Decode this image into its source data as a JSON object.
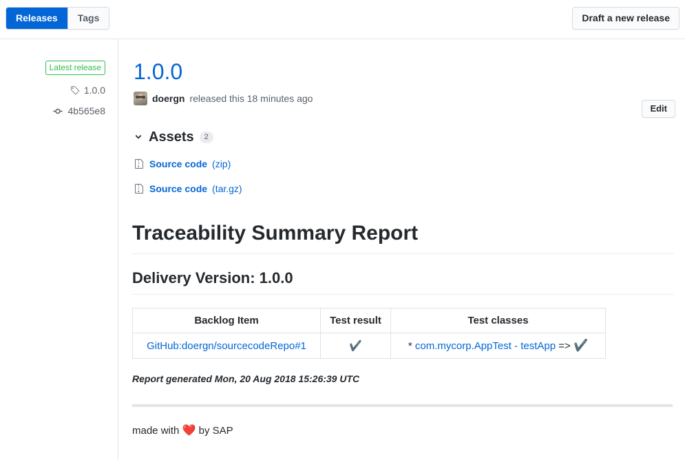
{
  "header": {
    "tabs": [
      {
        "label": "Releases",
        "selected": true
      },
      {
        "label": "Tags",
        "selected": false
      }
    ],
    "draft_button": "Draft a new release"
  },
  "sidebar": {
    "latest_badge": "Latest release",
    "tag": "1.0.0",
    "commit": "4b565e8",
    "tag_icon": "tag-icon",
    "commit_icon": "commit-icon"
  },
  "release": {
    "title": "1.0.0",
    "edit_button": "Edit",
    "author": "doergn",
    "byline_text": "released this 18 minutes ago"
  },
  "assets": {
    "chevron_icon": "chevron-down-icon",
    "label": "Assets",
    "count": "2",
    "items": [
      {
        "icon": "file-zip-icon",
        "name": "Source code",
        "ext": "(zip)"
      },
      {
        "icon": "file-zip-icon",
        "name": "Source code",
        "ext": "(tar.gz)"
      }
    ]
  },
  "report": {
    "title": "Traceability Summary Report",
    "subtitle": "Delivery Version: 1.0.0",
    "table": {
      "columns": [
        "Backlog Item",
        "Test result",
        "Test classes"
      ],
      "rows": [
        {
          "backlog_item": "GitHub:doergn/sourcecodeRepo#1",
          "test_result": "✔️",
          "test_classes_prefix": "* ",
          "test_classes_link": "com.mycorp.AppTest - testApp",
          "test_classes_arrow": " => ",
          "test_classes_result": "✔️"
        }
      ]
    },
    "generated": "Report generated Mon, 20 Aug 2018 15:26:39 UTC",
    "footer_prefix": "made with ",
    "footer_heart": "❤️",
    "footer_suffix": " by SAP"
  },
  "colors": {
    "accent_blue": "#0366d6",
    "badge_green": "#2cbe4e",
    "border_gray": "#e1e4e8",
    "muted_text": "#586069"
  }
}
